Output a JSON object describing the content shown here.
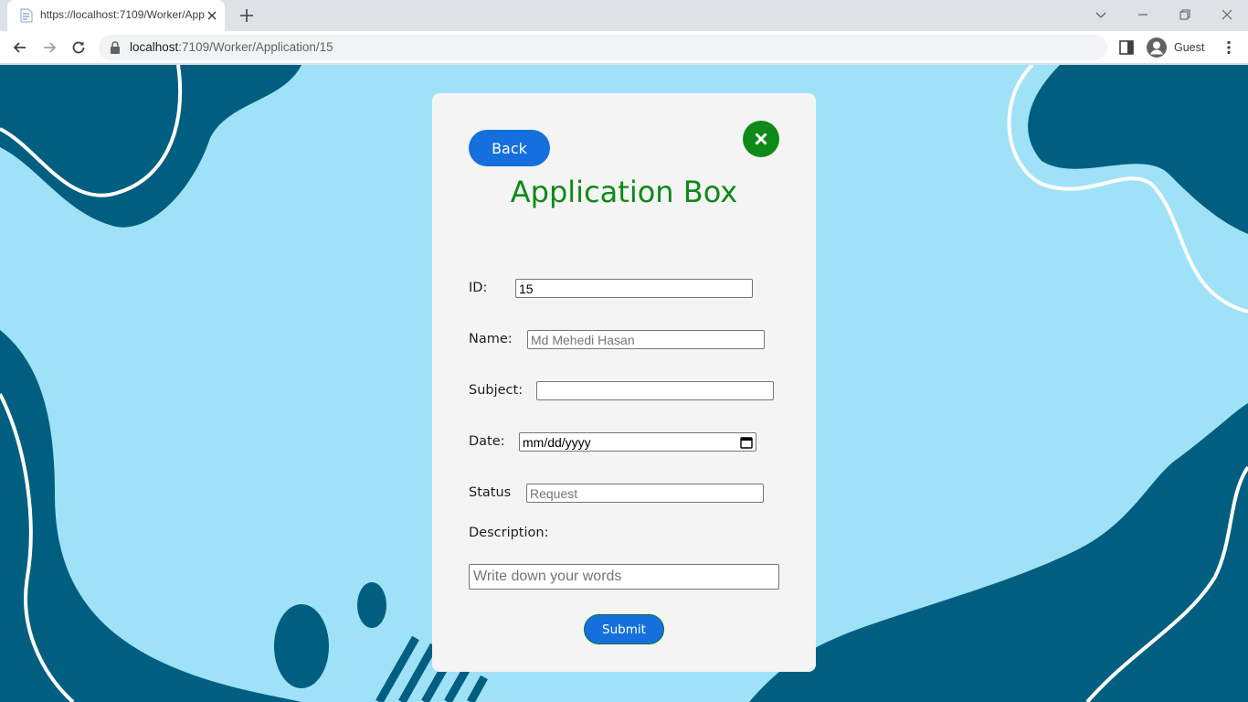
{
  "browser": {
    "tab_title": "https://localhost:7109/Worker/Application/15",
    "url_host": "localhost",
    "url_path": ":7109/Worker/Application/15",
    "profile_name": "Guest"
  },
  "icons": [
    "page-favicon-icon",
    "tab-close-icon",
    "new-tab-icon",
    "tab-search-icon",
    "minimize-icon",
    "restore-icon",
    "window-close-icon",
    "back-arrow-icon",
    "forward-arrow-icon",
    "reload-icon",
    "lock-icon",
    "side-panel-icon",
    "guest-avatar-icon",
    "menu-dots-icon",
    "close-x-icon",
    "calendar-icon"
  ],
  "colors": {
    "page_bg": "#9fe2f8",
    "blob": "#005f80",
    "accent_blue": "#1570dd",
    "accent_green": "#0d8a18",
    "card_bg": "#f4f4f4"
  },
  "form": {
    "back_label": "Back",
    "title": "Application Box",
    "id_label": "ID:",
    "id_value": "15",
    "name_label": "Name:",
    "name_placeholder": "Md Mehedi Hasan",
    "subject_label": "Subject:",
    "subject_value": "",
    "date_label": "Date:",
    "date_placeholder": "mm/dd/yyyy",
    "status_label": "Status",
    "status_placeholder": "Request",
    "description_label": "Description:",
    "description_placeholder": "Write down your words",
    "submit_label": "Submit"
  }
}
